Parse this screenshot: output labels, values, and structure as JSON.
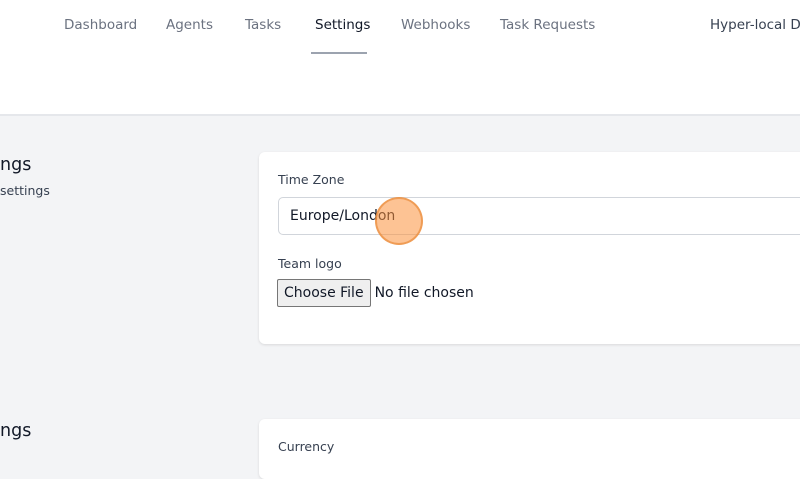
{
  "nav": {
    "items": [
      {
        "label": "Dashboard",
        "active": false
      },
      {
        "label": "Agents",
        "active": false
      },
      {
        "label": "Tasks",
        "active": false
      },
      {
        "label": "Settings",
        "active": true
      },
      {
        "label": "Webhooks",
        "active": false
      },
      {
        "label": "Task Requests",
        "active": false
      }
    ],
    "team_name": "Hyper-local Del"
  },
  "sections": [
    {
      "title": "ngs",
      "subtitle": "settings",
      "fields": {
        "timezone_label": "Time Zone",
        "timezone_value": "Europe/London",
        "logo_label": "Team logo",
        "logo_button": "Choose File",
        "logo_status": "No file chosen"
      }
    },
    {
      "title": "ngs",
      "fields": {
        "currency_label": "Currency"
      }
    }
  ],
  "colors": {
    "page_bg": "#f3f4f6",
    "cursor_highlight": "#fb923c"
  }
}
